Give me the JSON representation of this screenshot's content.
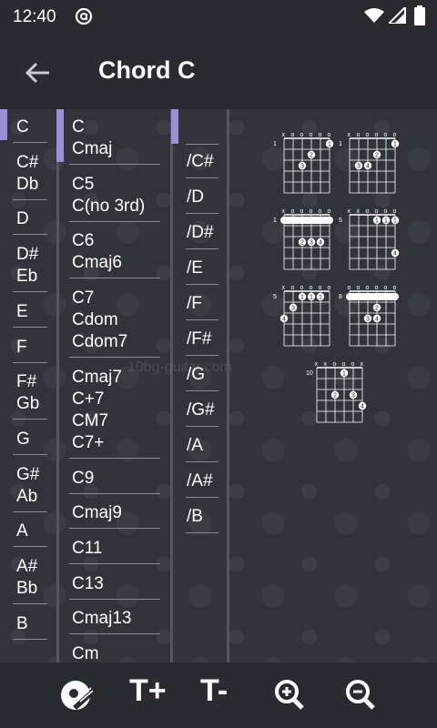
{
  "status_bar": {
    "time": "12:40",
    "icons": [
      "notification-at-icon",
      "wifi-icon",
      "cell-signal-icon",
      "battery-icon"
    ]
  },
  "app_bar": {
    "title": "Chord C",
    "back_icon": "arrow-left-icon"
  },
  "root_notes": [
    [
      "C"
    ],
    [
      "C#",
      "Db"
    ],
    [
      "D"
    ],
    [
      "D#",
      "Eb"
    ],
    [
      "E"
    ],
    [
      "F"
    ],
    [
      "F#",
      "Gb"
    ],
    [
      "G"
    ],
    [
      "G#",
      "Ab"
    ],
    [
      "A"
    ],
    [
      "A#",
      "Bb"
    ],
    [
      "B"
    ]
  ],
  "chord_types": [
    [
      "C",
      "Cmaj"
    ],
    [
      "C5",
      "C(no 3rd)"
    ],
    [
      "C6",
      "Cmaj6"
    ],
    [
      "C7",
      "Cdom",
      "Cdom7"
    ],
    [
      "Cmaj7",
      "C+7",
      "CM7",
      "C7+"
    ],
    [
      "C9"
    ],
    [
      "Cmaj9"
    ],
    [
      "C11"
    ],
    [
      "C13"
    ],
    [
      "Cmaj13"
    ],
    [
      "Cm"
    ]
  ],
  "bass_notes": [
    "/C#",
    "/D",
    "/D#",
    "/E",
    "/F",
    "/F#",
    "/G",
    "/G#",
    "/A",
    "/A#",
    "/B"
  ],
  "selected": {
    "root": "C",
    "chord_type": "C"
  },
  "watermark": "10bg-guitar.com",
  "chord_diagrams": [
    {
      "fret_label": "1",
      "markers": "xooooo",
      "dots": [
        [
          1,
          5,
          "1"
        ],
        [
          2,
          3,
          "2"
        ],
        [
          3,
          2,
          "3"
        ]
      ]
    },
    {
      "fret_label": "1",
      "markers": "xooooo",
      "dots": [
        [
          1,
          5,
          "1"
        ],
        [
          2,
          3,
          "2"
        ],
        [
          3,
          1,
          "3"
        ],
        [
          3,
          2,
          "4"
        ]
      ]
    },
    {
      "fret_label": "1",
      "markers": "xooooo",
      "barre": [
        1,
        0,
        5
      ],
      "dots": [
        [
          3,
          2,
          "2"
        ],
        [
          3,
          3,
          "3"
        ],
        [
          3,
          4,
          "4"
        ]
      ]
    },
    {
      "fret_label": "5",
      "markers": "xxoooo",
      "dots": [
        [
          1,
          3,
          "1"
        ],
        [
          1,
          4,
          "1"
        ],
        [
          1,
          5,
          "1"
        ],
        [
          4,
          6,
          "4"
        ]
      ]
    },
    {
      "fret_label": "5",
      "markers": "xooooo",
      "dots": [
        [
          1,
          2,
          "1"
        ],
        [
          1,
          3,
          "1"
        ],
        [
          1,
          4,
          "1"
        ],
        [
          3,
          0,
          "4"
        ],
        [
          2,
          1,
          "3"
        ]
      ]
    },
    {
      "fret_label": "8",
      "markers": "oooooo",
      "barre": [
        1,
        0,
        5
      ],
      "dots": [
        [
          2,
          3,
          "2"
        ],
        [
          3,
          2,
          "3"
        ],
        [
          3,
          3,
          "4"
        ]
      ]
    },
    {
      "fret_label": "10",
      "markers": "xxooox",
      "dots": [
        [
          1,
          3,
          "1"
        ],
        [
          3,
          2,
          "2"
        ],
        [
          3,
          4,
          "3"
        ],
        [
          4,
          5,
          "4"
        ]
      ]
    }
  ],
  "bottom_bar": {
    "guitar_icon": "guitar-pick-icon",
    "text_bigger": "T+",
    "text_smaller": "T-",
    "zoom_in_icon": "zoom-in-icon",
    "zoom_out_icon": "zoom-out-icon"
  }
}
